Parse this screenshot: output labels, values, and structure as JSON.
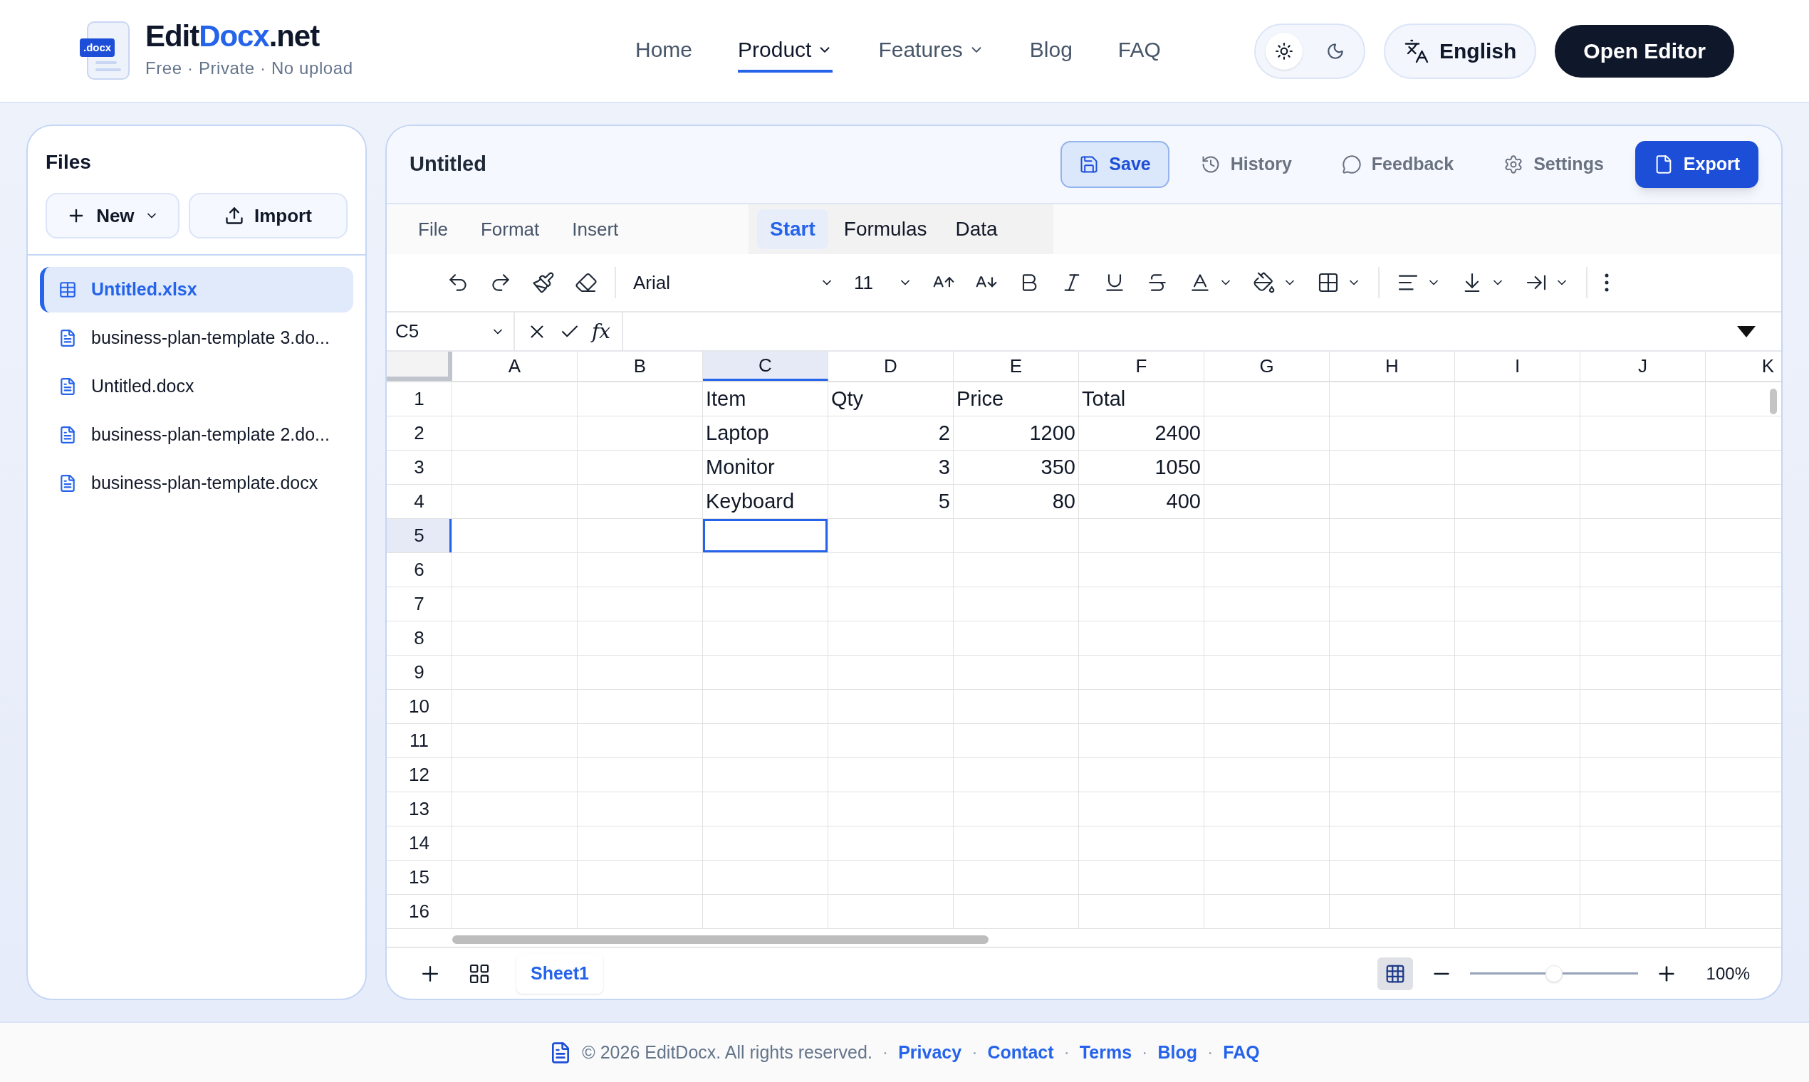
{
  "header": {
    "logo_badge": ".docx",
    "brand": [
      {
        "text": "Edit",
        "accent": false
      },
      {
        "text": "Docx",
        "accent": true
      },
      {
        "text": ".net",
        "accent": false
      }
    ],
    "tagline": "Free · Private · No upload",
    "nav": [
      {
        "label": "Home",
        "selected": false,
        "dropdown": false
      },
      {
        "label": "Product",
        "selected": true,
        "dropdown": true
      },
      {
        "label": "Features",
        "selected": false,
        "dropdown": true
      },
      {
        "label": "Blog",
        "selected": false,
        "dropdown": false
      },
      {
        "label": "FAQ",
        "selected": false,
        "dropdown": false
      }
    ],
    "theme": [
      {
        "kind": "light",
        "selected": true
      },
      {
        "kind": "dark",
        "selected": false
      }
    ],
    "language": "English",
    "cta": "Open Editor"
  },
  "sidebar": {
    "title": "Files",
    "buttons": [
      {
        "label": "New",
        "kind": "new"
      },
      {
        "label": "Import",
        "kind": "import"
      }
    ],
    "files": [
      {
        "name": "Untitled.xlsx",
        "kind": "sheet",
        "selected": true
      },
      {
        "name": "business-plan-template 3.do...",
        "kind": "doc",
        "selected": false
      },
      {
        "name": "Untitled.docx",
        "kind": "doc",
        "selected": false
      },
      {
        "name": "business-plan-template 2.do...",
        "kind": "doc",
        "selected": false
      },
      {
        "name": "business-plan-template.docx",
        "kind": "doc",
        "selected": false
      }
    ]
  },
  "editor": {
    "title": "Untitled",
    "actions": [
      {
        "label": "Save",
        "kind": "save"
      },
      {
        "label": "History",
        "kind": "history"
      },
      {
        "label": "Feedback",
        "kind": "feedback"
      },
      {
        "label": "Settings",
        "kind": "settings"
      },
      {
        "label": "Export",
        "kind": "export"
      }
    ],
    "menus": [
      "File",
      "Format",
      "Insert"
    ],
    "ribbon_tabs": [
      {
        "label": "Start",
        "selected": true
      },
      {
        "label": "Formulas",
        "selected": false
      },
      {
        "label": "Data",
        "selected": false
      }
    ],
    "toolbar": {
      "font": "Arial",
      "size": "11"
    },
    "formula_bar": {
      "cell_ref": "C5",
      "function_label": "fx"
    },
    "grid": {
      "columns": [
        {
          "label": "A",
          "selected": false
        },
        {
          "label": "B",
          "selected": false
        },
        {
          "label": "C",
          "selected": true
        },
        {
          "label": "D",
          "selected": false
        },
        {
          "label": "E",
          "selected": false
        },
        {
          "label": "F",
          "selected": false
        },
        {
          "label": "G",
          "selected": false
        },
        {
          "label": "H",
          "selected": false
        },
        {
          "label": "I",
          "selected": false
        },
        {
          "label": "J",
          "selected": false
        },
        {
          "label": "K",
          "selected": false
        }
      ],
      "rows": [
        {
          "label": "1",
          "selected": false,
          "cells": [
            {
              "selected": false
            },
            {
              "selected": false
            },
            {
              "value": "Item",
              "kind": "text",
              "selected": false
            },
            {
              "value": "Qty",
              "kind": "text",
              "selected": false
            },
            {
              "value": "Price",
              "kind": "text",
              "selected": false
            },
            {
              "value": "Total",
              "kind": "text",
              "selected": false
            }
          ]
        },
        {
          "label": "2",
          "selected": false,
          "cells": [
            {
              "selected": false
            },
            {
              "selected": false
            },
            {
              "value": "Laptop",
              "kind": "text",
              "selected": false
            },
            {
              "value": "2",
              "kind": "number",
              "selected": false
            },
            {
              "value": "1200",
              "kind": "number",
              "selected": false
            },
            {
              "value": "2400",
              "kind": "number",
              "selected": false
            }
          ]
        },
        {
          "label": "3",
          "selected": false,
          "cells": [
            {
              "selected": false
            },
            {
              "selected": false
            },
            {
              "value": "Monitor",
              "kind": "text",
              "selected": false
            },
            {
              "value": "3",
              "kind": "number",
              "selected": false
            },
            {
              "value": "350",
              "kind": "number",
              "selected": false
            },
            {
              "value": "1050",
              "kind": "number",
              "selected": false
            }
          ]
        },
        {
          "label": "4",
          "selected": false,
          "cells": [
            {
              "selected": false
            },
            {
              "selected": false
            },
            {
              "value": "Keyboard",
              "kind": "text",
              "selected": false
            },
            {
              "value": "5",
              "kind": "number",
              "selected": false
            },
            {
              "value": "80",
              "kind": "number",
              "selected": false
            },
            {
              "value": "400",
              "kind": "number",
              "selected": false
            }
          ]
        },
        {
          "label": "5",
          "selected": true,
          "cells": [
            {
              "selected": false
            },
            {
              "selected": false
            },
            {
              "selected": true
            }
          ]
        },
        {
          "label": "6",
          "selected": false
        },
        {
          "label": "7",
          "selected": false
        },
        {
          "label": "8",
          "selected": false
        },
        {
          "label": "9",
          "selected": false
        },
        {
          "label": "10",
          "selected": false
        },
        {
          "label": "11",
          "selected": false
        },
        {
          "label": "12",
          "selected": false
        },
        {
          "label": "13",
          "selected": false
        },
        {
          "label": "14",
          "selected": false
        },
        {
          "label": "15",
          "selected": false
        },
        {
          "label": "16",
          "selected": false
        }
      ]
    },
    "sheets": [
      {
        "label": "Sheet1",
        "selected": true
      }
    ],
    "gridlines": {
      "on": true
    },
    "zoom": {
      "level": 0.5,
      "reading": "100%"
    }
  },
  "footer": {
    "copyright": "© 2026 EditDocx. All rights reserved.",
    "links": [
      {
        "separator": "·",
        "label": "Privacy"
      },
      {
        "separator": "·",
        "label": "Contact"
      },
      {
        "separator": "·",
        "label": "Terms"
      },
      {
        "separator": "·",
        "label": "Blog"
      },
      {
        "separator": "·",
        "label": "FAQ"
      }
    ]
  }
}
